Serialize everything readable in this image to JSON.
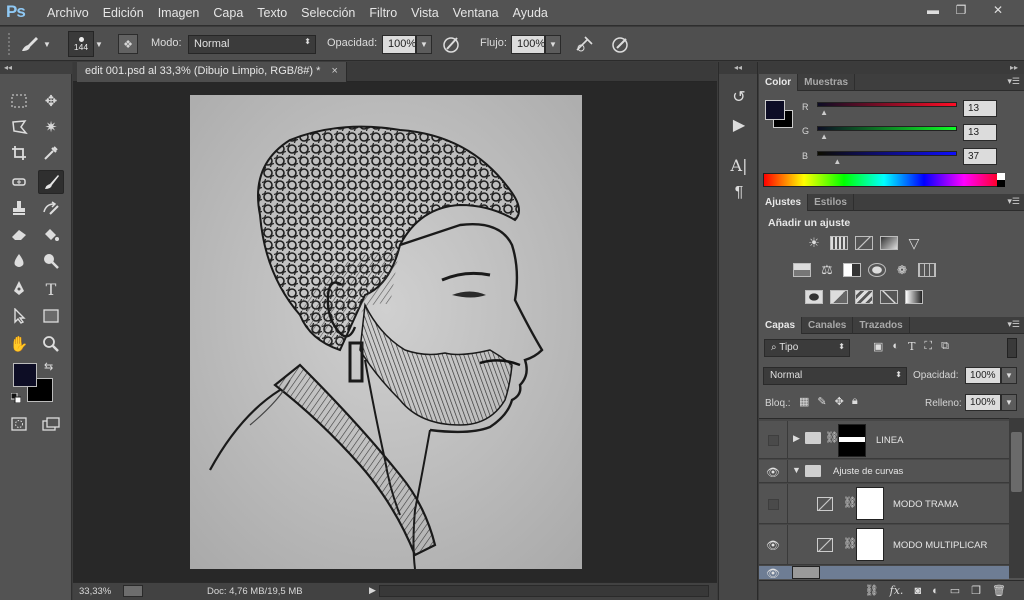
{
  "app": {
    "logo": "Ps"
  },
  "menu": [
    "Archivo",
    "Edición",
    "Imagen",
    "Capa",
    "Texto",
    "Selección",
    "Filtro",
    "Vista",
    "Ventana",
    "Ayuda"
  ],
  "window_controls": {
    "minimize": "▬",
    "restore": "❐",
    "close": "✕"
  },
  "options": {
    "brush_size": "144",
    "mode_label": "Modo:",
    "mode_value": "Normal",
    "opacity_label": "Opacidad:",
    "opacity_value": "100%",
    "flow_label": "Flujo:",
    "flow_value": "100%"
  },
  "document": {
    "tab_title": "edit 001.psd al 33,3% (Dibujo Limpio, RGB/8#) *",
    "close": "×",
    "zoom": "33,33%",
    "doc_info": "Doc: 4,76 MB/19,5 MB"
  },
  "colors": {
    "foreground": "#0d0d25",
    "background": "#000000",
    "panel_bg": "#535353",
    "canvas_bg": "#282828"
  },
  "color_panel": {
    "tabs": [
      "Color",
      "Muestras"
    ],
    "r_label": "R",
    "r_value": "13",
    "r": 13,
    "g_label": "G",
    "g_value": "13",
    "g": 13,
    "b_label": "B",
    "b_value": "37",
    "b": 37
  },
  "adjustments_panel": {
    "tabs": [
      "Ajustes",
      "Estilos"
    ],
    "heading": "Añadir un ajuste"
  },
  "layers_panel": {
    "tabs": [
      "Capas",
      "Canales",
      "Trazados"
    ],
    "filter_label": "Tipo",
    "blend_mode": "Normal",
    "opacity_label": "Opacidad:",
    "opacity_value": "100%",
    "lock_label": "Bloq.:",
    "fill_label": "Relleno:",
    "fill_value": "100%",
    "layers": [
      {
        "name": "LINEA",
        "visible": false
      },
      {
        "name": "Ajuste de curvas",
        "visible": true
      },
      {
        "name": "MODO TRAMA",
        "visible": false
      },
      {
        "name": "MODO MULTIPLICAR",
        "visible": true
      }
    ],
    "footer_fx": "fx."
  }
}
